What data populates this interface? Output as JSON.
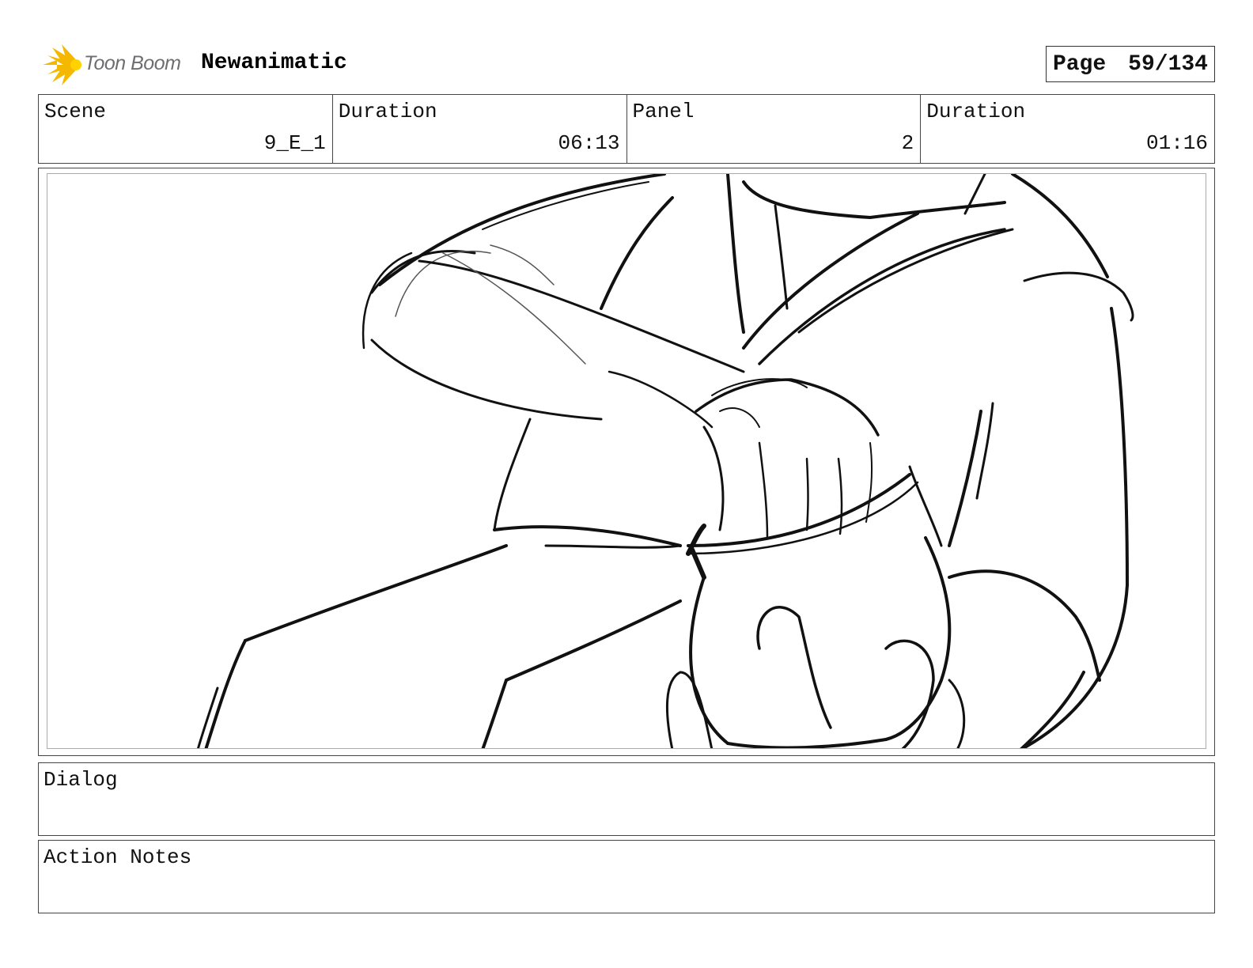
{
  "header": {
    "logo_text": "Toon Boom",
    "project_title": "Newanimatic",
    "page_label": "Page",
    "page_value": "59/134"
  },
  "info": [
    {
      "label": "Scene",
      "value": "9_E_1"
    },
    {
      "label": "Duration",
      "value": "06:13"
    },
    {
      "label": "Panel",
      "value": "2"
    },
    {
      "label": "Duration",
      "value": "01:16"
    }
  ],
  "panel": {
    "image": "rough pencil sketch of a hand gripping a wrapped bundle"
  },
  "dialog": {
    "label": "Dialog"
  },
  "action_notes": {
    "label": "Action Notes"
  },
  "colors": {
    "logo_star": "#f5b800",
    "logo_text": "#6d6e71",
    "border": "#444444"
  }
}
